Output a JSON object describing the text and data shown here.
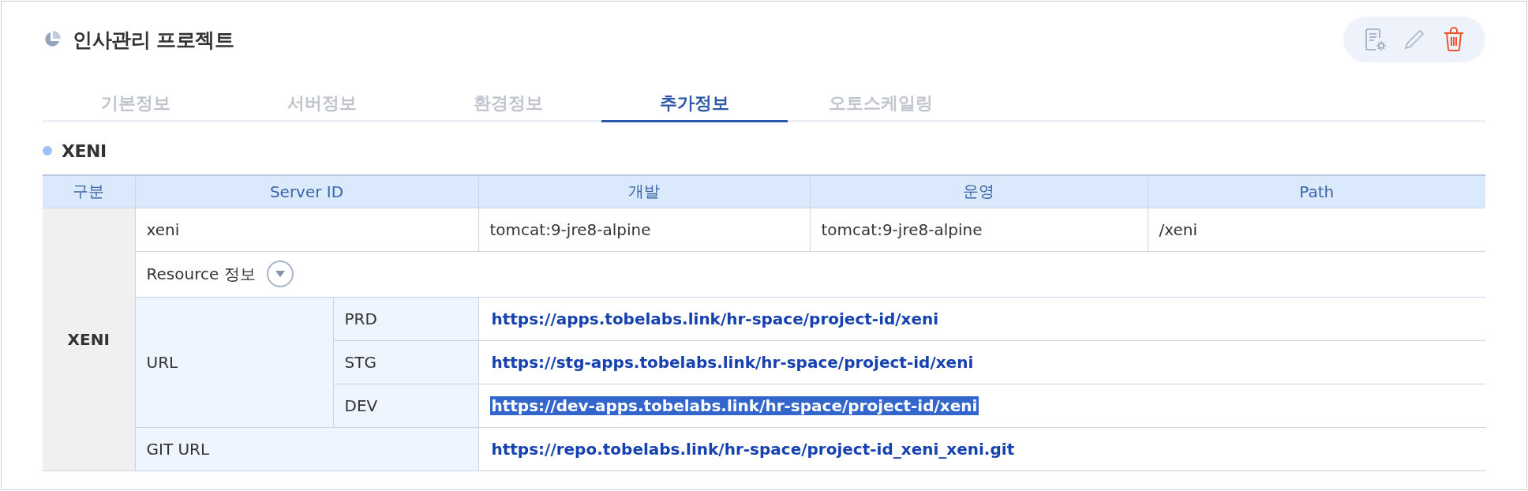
{
  "project": {
    "title": "인사관리 프로젝트"
  },
  "tabs": [
    {
      "label": "기본정보",
      "selected": false
    },
    {
      "label": "서버정보",
      "selected": false
    },
    {
      "label": "환경정보",
      "selected": false
    },
    {
      "label": "추가정보",
      "selected": true
    },
    {
      "label": "오토스케일링",
      "selected": false
    }
  ],
  "section": {
    "title": "XENI"
  },
  "table": {
    "columns": [
      "구분",
      "Server ID",
      "개발",
      "운영",
      "Path"
    ],
    "group": "XENI",
    "server": {
      "id": "xeni",
      "dev": "tomcat:9-jre8-alpine",
      "prod": "tomcat:9-jre8-alpine",
      "path": "/xeni"
    },
    "resource": {
      "label": "Resource 정보",
      "expanded": false
    },
    "url": {
      "label": "URL",
      "rows": [
        {
          "env": "PRD",
          "link": "https://apps.tobelabs.link/hr-space/project-id/xeni",
          "selected": false
        },
        {
          "env": "STG",
          "link": "https://stg-apps.tobelabs.link/hr-space/project-id/xeni",
          "selected": false
        },
        {
          "env": "DEV",
          "link": "https://dev-apps.tobelabs.link/hr-space/project-id/xeni",
          "selected": true
        }
      ]
    },
    "git": {
      "label": "GIT URL",
      "link": "https://repo.tobelabs.link/hr-space/project-id_xeni_xeni.git"
    }
  }
}
